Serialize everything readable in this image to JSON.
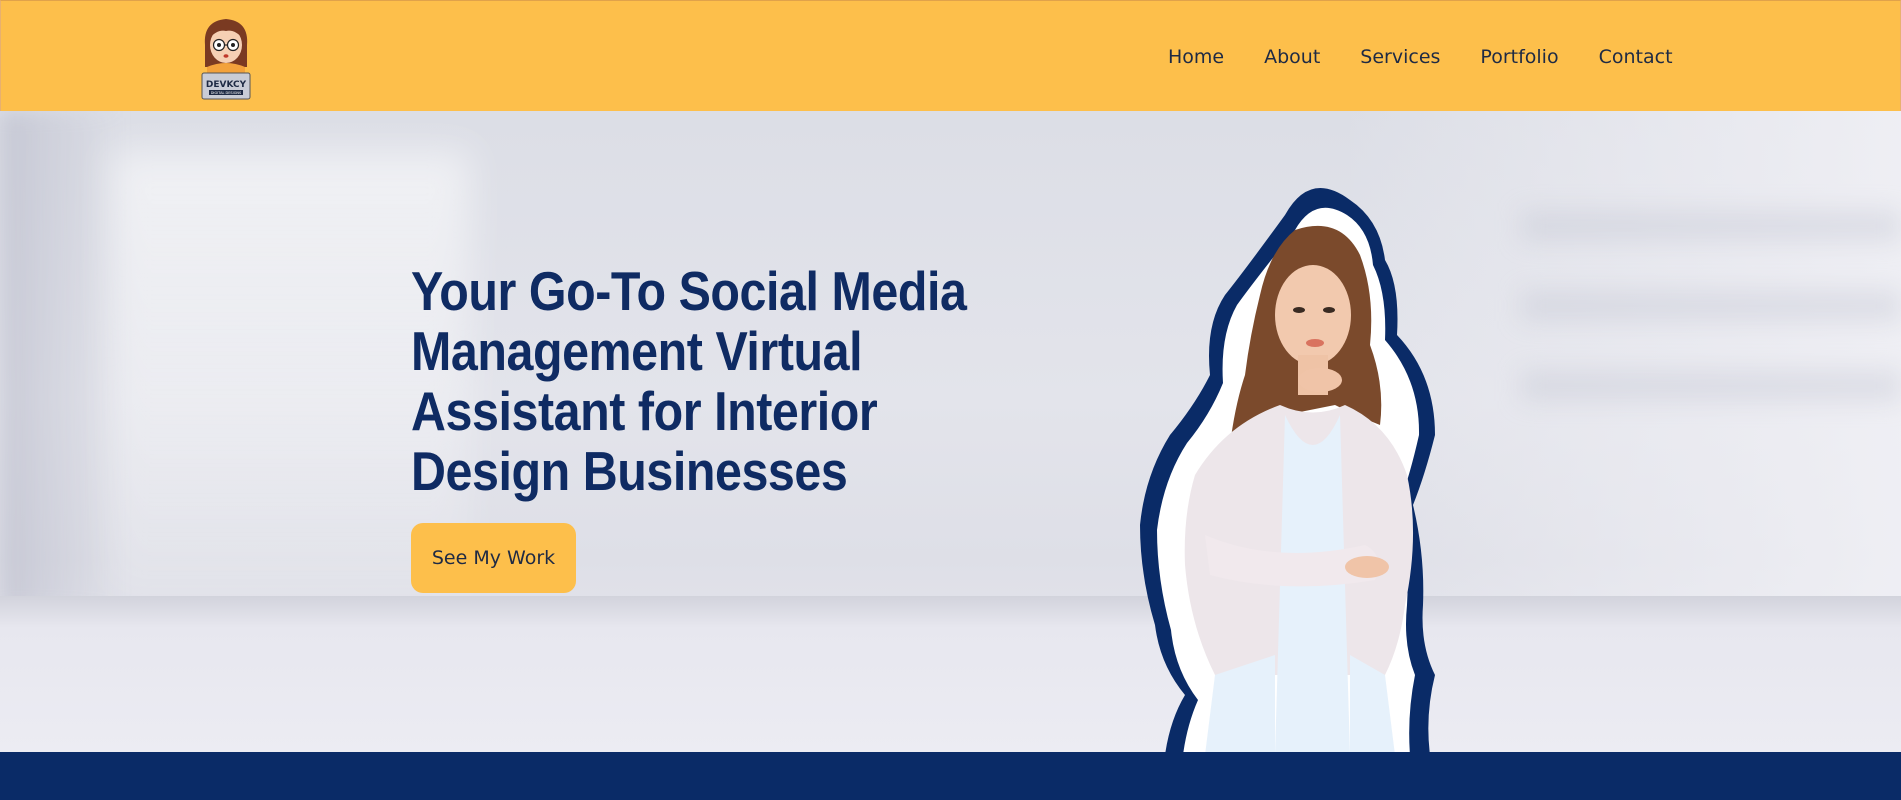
{
  "header": {
    "logo": {
      "icon": "avatar-logo-icon",
      "text_line1": "DEVKCY",
      "text_line2": "DIGITAL DESIGNS"
    },
    "nav": [
      {
        "label": "Home"
      },
      {
        "label": "About"
      },
      {
        "label": "Services"
      },
      {
        "label": "Portfolio"
      },
      {
        "label": "Contact"
      }
    ]
  },
  "hero": {
    "title": "Your Go-To Social Media Management Virtual Assistant for Interior Design Businesses",
    "cta_label": "See My Work",
    "image": "portrait-photo"
  },
  "colors": {
    "header_bg": "#fdbf4b",
    "primary_navy": "#0f2b63",
    "bottom_band": "#0a2b67",
    "cta_bg": "#fdbf4b",
    "nav_text": "#1e2a44"
  }
}
